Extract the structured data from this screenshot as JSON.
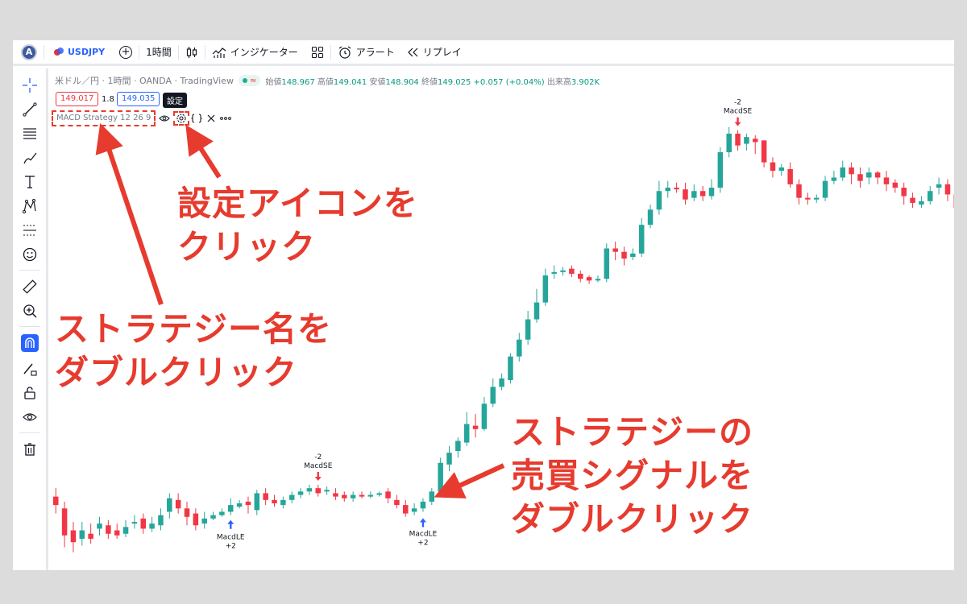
{
  "toolbar": {
    "avatar_letter": "A",
    "symbol": "USDJPY",
    "interval": "1時間",
    "indicators": "インジケーター",
    "alert": "アラート",
    "replay": "リプレイ"
  },
  "legend": {
    "title": "米ドル／円 · 1時間 · OANDA · TradingView",
    "open_label": "始値",
    "open": "148.967",
    "high_label": "高値",
    "high": "149.041",
    "low_label": "安値",
    "low": "148.904",
    "close_label": "終値",
    "close": "149.025",
    "change": "+0.057 (+0.04%)",
    "volume_label": "出来高",
    "volume": "3.902K"
  },
  "prices": {
    "sell": "149.017",
    "spread": "1.8",
    "buy": "149.035"
  },
  "tooltip": "設定",
  "strategy": {
    "name": "MACD Strategy 12 26 9"
  },
  "signals": {
    "long1_label": "MacdLE",
    "long1_qty": "+2",
    "short1_qty": "-2",
    "short1_label": "MacdSE",
    "long2_label": "MacdLE",
    "long2_qty": "+2",
    "short2_qty": "-2",
    "short2_label": "MacdSE"
  },
  "annotations": {
    "settings_line1": "設定アイコンを",
    "settings_line2": "クリック",
    "name_line1": "ストラテジー名を",
    "name_line2": "ダブルクリック",
    "signal_line1": "ストラテジーの",
    "signal_line2": "売買シグナルを",
    "signal_line3": "ダブルクリック"
  },
  "colors": {
    "up": "#26a69a",
    "down": "#f23645",
    "annotation": "#e63b2e",
    "accent": "#2962ff"
  },
  "chart_data": {
    "type": "candlestick",
    "symbol": "USDJPY",
    "interval": "1時間",
    "candles": [
      [
        148.15,
        148.1,
        148.2,
        148.05
      ],
      [
        148.08,
        147.92,
        148.12,
        147.85
      ],
      [
        147.95,
        147.88,
        148.0,
        147.82
      ],
      [
        147.9,
        147.95,
        148.0,
        147.86
      ],
      [
        147.93,
        147.9,
        147.99,
        147.87
      ],
      [
        147.96,
        147.99,
        148.03,
        147.92
      ],
      [
        147.98,
        147.93,
        148.01,
        147.9
      ],
      [
        147.95,
        147.92,
        147.99,
        147.9
      ],
      [
        147.93,
        147.97,
        148.01,
        147.91
      ],
      [
        147.99,
        148.0,
        148.04,
        147.96
      ],
      [
        148.02,
        147.96,
        148.05,
        147.93
      ],
      [
        147.96,
        147.99,
        148.03,
        147.94
      ],
      [
        147.98,
        148.04,
        148.08,
        147.95
      ],
      [
        148.06,
        148.14,
        148.17,
        148.02
      ],
      [
        148.13,
        148.08,
        148.17,
        148.05
      ],
      [
        148.08,
        148.03,
        148.12,
        147.98
      ],
      [
        148.05,
        147.98,
        148.08,
        147.95
      ],
      [
        147.99,
        148.02,
        148.06,
        147.96
      ],
      [
        148.02,
        148.04,
        148.06,
        148.01
      ],
      [
        148.04,
        148.06,
        148.08,
        148.03
      ],
      [
        148.06,
        148.1,
        148.14,
        148.04
      ],
      [
        148.09,
        148.11,
        148.13,
        148.08
      ],
      [
        148.12,
        148.1,
        148.15,
        148.05
      ],
      [
        148.07,
        148.17,
        148.19,
        148.04
      ],
      [
        148.17,
        148.13,
        148.2,
        148.1
      ],
      [
        148.13,
        148.11,
        148.16,
        148.09
      ],
      [
        148.1,
        148.13,
        148.15,
        148.08
      ],
      [
        148.13,
        148.16,
        148.18,
        148.11
      ],
      [
        148.16,
        148.18,
        148.2,
        148.14
      ],
      [
        148.18,
        148.2,
        148.22,
        148.16
      ],
      [
        148.2,
        148.17,
        148.22,
        148.15
      ],
      [
        148.18,
        148.19,
        148.21,
        148.16
      ],
      [
        148.17,
        148.15,
        148.2,
        148.13
      ],
      [
        148.16,
        148.14,
        148.18,
        148.12
      ],
      [
        148.14,
        148.16,
        148.18,
        148.12
      ],
      [
        148.16,
        148.15,
        148.18,
        148.14
      ],
      [
        148.15,
        148.16,
        148.18,
        148.14
      ],
      [
        148.16,
        148.17,
        148.18,
        148.15
      ],
      [
        148.18,
        148.14,
        148.2,
        148.11
      ],
      [
        148.13,
        148.1,
        148.16,
        148.08
      ],
      [
        148.1,
        148.05,
        148.13,
        148.03
      ],
      [
        148.06,
        148.08,
        148.11,
        148.04
      ],
      [
        148.08,
        148.12,
        148.14,
        148.06
      ],
      [
        148.12,
        148.18,
        148.2,
        148.1
      ],
      [
        148.18,
        148.35,
        148.38,
        148.16
      ],
      [
        148.34,
        148.41,
        148.45,
        148.3
      ],
      [
        148.42,
        148.48,
        148.5,
        148.38
      ],
      [
        148.47,
        148.58,
        148.65,
        148.45
      ],
      [
        148.57,
        148.55,
        148.64,
        148.5
      ],
      [
        148.55,
        148.7,
        148.74,
        148.54
      ],
      [
        148.7,
        148.8,
        148.85,
        148.68
      ],
      [
        148.8,
        148.85,
        148.88,
        148.78
      ],
      [
        148.84,
        148.98,
        149.0,
        148.82
      ],
      [
        148.98,
        149.08,
        149.12,
        148.95
      ],
      [
        149.08,
        149.2,
        149.25,
        149.05
      ],
      [
        149.2,
        149.3,
        149.38,
        149.18
      ],
      [
        149.3,
        149.46,
        149.5,
        149.28
      ],
      [
        149.47,
        149.48,
        149.52,
        149.44
      ],
      [
        149.48,
        149.49,
        149.51,
        149.46
      ],
      [
        149.5,
        149.47,
        149.52,
        149.45
      ],
      [
        149.47,
        149.44,
        149.49,
        149.42
      ],
      [
        149.45,
        149.43,
        149.46,
        149.41
      ],
      [
        149.43,
        149.44,
        149.46,
        149.42
      ],
      [
        149.44,
        149.62,
        149.65,
        149.42
      ],
      [
        149.62,
        149.6,
        149.66,
        149.55
      ],
      [
        149.6,
        149.56,
        149.63,
        149.52
      ],
      [
        149.57,
        149.59,
        149.62,
        149.55
      ],
      [
        149.59,
        149.76,
        149.8,
        149.57
      ],
      [
        149.76,
        149.85,
        149.88,
        149.74
      ],
      [
        149.85,
        149.96,
        150.02,
        149.82
      ],
      [
        149.96,
        149.98,
        150.02,
        149.92
      ],
      [
        149.98,
        149.97,
        150.01,
        149.95
      ],
      [
        149.97,
        149.91,
        150.01,
        149.88
      ],
      [
        149.92,
        149.96,
        150.0,
        149.9
      ],
      [
        149.96,
        149.93,
        149.99,
        149.9
      ],
      [
        149.93,
        149.98,
        150.03,
        149.91
      ],
      [
        149.98,
        150.19,
        150.22,
        149.95
      ],
      [
        150.19,
        150.3,
        150.34,
        150.16
      ],
      [
        150.3,
        150.23,
        150.32,
        150.2
      ],
      [
        150.24,
        150.28,
        150.3,
        150.2
      ],
      [
        150.27,
        150.25,
        150.29,
        150.18
      ],
      [
        150.26,
        150.13,
        150.2,
        150.1
      ],
      [
        150.13,
        150.08,
        150.16,
        150.04
      ],
      [
        150.08,
        150.1,
        150.12,
        150.05
      ],
      [
        150.09,
        150.0,
        150.13,
        149.98
      ],
      [
        150.0,
        149.92,
        150.03,
        149.88
      ],
      [
        149.92,
        149.91,
        149.95,
        149.88
      ],
      [
        149.91,
        149.92,
        149.94,
        149.89
      ],
      [
        149.92,
        150.02,
        150.05,
        149.9
      ],
      [
        150.02,
        150.04,
        150.08,
        150.0
      ],
      [
        150.04,
        150.1,
        150.14,
        150.02
      ],
      [
        150.1,
        150.06,
        150.13,
        150.0
      ],
      [
        150.06,
        150.02,
        150.1,
        149.98
      ],
      [
        150.04,
        150.07,
        150.1,
        150.0
      ],
      [
        150.07,
        150.04,
        150.08,
        150.0
      ],
      [
        150.04,
        150.0,
        150.08,
        149.96
      ],
      [
        150.01,
        149.98,
        150.03,
        149.95
      ],
      [
        149.98,
        149.93,
        150.01,
        149.88
      ],
      [
        149.92,
        149.89,
        149.95,
        149.86
      ],
      [
        149.88,
        149.9,
        149.93,
        149.86
      ],
      [
        149.9,
        149.96,
        149.99,
        149.88
      ],
      [
        149.98,
        150.0,
        150.04,
        149.94
      ],
      [
        150.0,
        149.94,
        150.03,
        149.9
      ],
      [
        149.94,
        149.86,
        149.97,
        149.83
      ],
      [
        149.87,
        149.82,
        149.89,
        149.78
      ],
      [
        149.82,
        149.9,
        149.95,
        149.8
      ],
      [
        149.9,
        150.02,
        150.09,
        149.88
      ],
      [
        150.03,
        150.0,
        150.08,
        149.97
      ],
      [
        150.0,
        150.0,
        150.08,
        149.99
      ],
      [
        150.01,
        150.02,
        150.06,
        149.97
      ]
    ]
  }
}
